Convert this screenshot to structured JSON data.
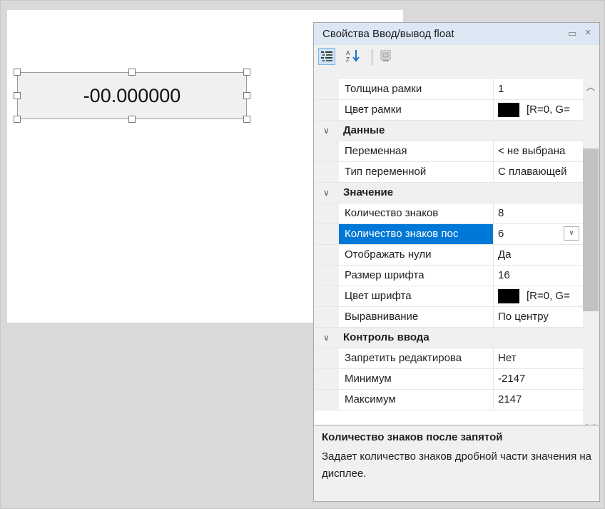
{
  "widget": {
    "value": "-00.000000"
  },
  "panel": {
    "title": "Свойства Ввод/вывод float",
    "restore_glyph": "▭",
    "close_glyph": "×"
  },
  "toolbar": {
    "icons": [
      "categorized-icon",
      "sort-alphabetical-icon",
      "property-pages-icon"
    ]
  },
  "properties": [
    {
      "type": "prop",
      "name": "Толщина рамки",
      "value": "1"
    },
    {
      "type": "prop",
      "name": "Цвет рамки",
      "value": "[R=0, G=",
      "swatch": "#000000"
    },
    {
      "type": "cat",
      "name": "Данные"
    },
    {
      "type": "prop",
      "name": "Переменная",
      "value": "< не выбрана"
    },
    {
      "type": "prop",
      "name": "Тип переменной",
      "value": "С плавающей"
    },
    {
      "type": "cat",
      "name": "Значение"
    },
    {
      "type": "prop",
      "name": "Количество знаков",
      "value": "8"
    },
    {
      "type": "prop",
      "name": "Количество знаков пос",
      "value": "6",
      "selected": true
    },
    {
      "type": "prop",
      "name": "Отображать нули",
      "value": "Да"
    },
    {
      "type": "prop",
      "name": "Размер шрифта",
      "value": "16"
    },
    {
      "type": "prop",
      "name": "Цвет шрифта",
      "value": "[R=0, G=",
      "swatch": "#000000"
    },
    {
      "type": "prop",
      "name": "Выравнивание",
      "value": "По центру"
    },
    {
      "type": "cat",
      "name": "Контроль ввода"
    },
    {
      "type": "prop",
      "name": "Запретить редактирова",
      "value": "Нет"
    },
    {
      "type": "prop",
      "name": "Минимум",
      "value": "-2147"
    },
    {
      "type": "prop",
      "name": "Максимум",
      "value": "2147"
    }
  ],
  "description": {
    "title": "Количество знаков после запятой",
    "text": "Задает количество знаков дробной части значения на дисплее."
  },
  "colors": {
    "selection": "#0078d7",
    "titlebar": "#dce7f4"
  }
}
